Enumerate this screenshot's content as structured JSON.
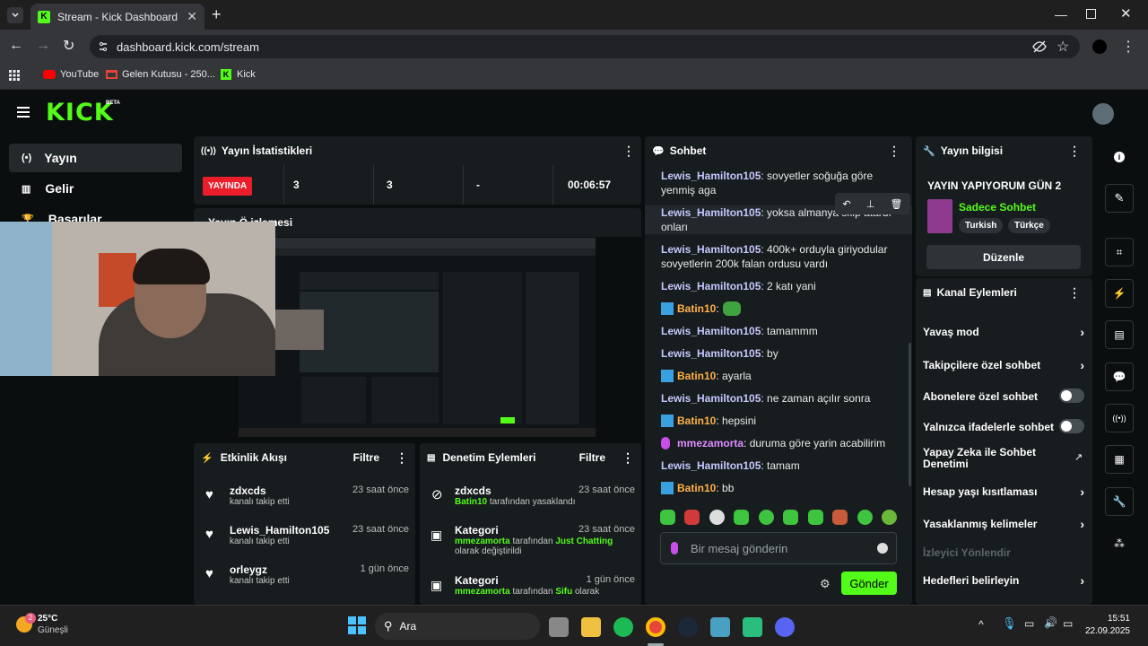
{
  "browser": {
    "tab_title": "Stream - Kick Dashboard",
    "url": "dashboard.kick.com/stream",
    "bookmarks": [
      "YouTube",
      "Gelen Kutusu - 250...",
      "Kick"
    ]
  },
  "brand": {
    "logo": "KICK",
    "beta": "BETA",
    "accent": "#53fc18"
  },
  "sidebar": {
    "items": [
      {
        "label": "Yayın"
      },
      {
        "label": "Gelir"
      },
      {
        "label": "Başarılar"
      }
    ]
  },
  "stats": {
    "title": "Yayın İstatistikleri",
    "live_badge": "YAYINDA",
    "values": [
      "3",
      "3",
      "-",
      "00:06:57"
    ]
  },
  "preview": {
    "title": "Yayın Önizlemesi",
    "title_visible": "Yayın Ö  izlemesi"
  },
  "activity": {
    "title": "Etkinlik Akışı",
    "filter": "Filtre",
    "items": [
      {
        "name": "zdxcds",
        "action": "kanalı takip etti",
        "time": "23 saat önce"
      },
      {
        "name": "Lewis_Hamilton105",
        "action": "kanalı takip etti",
        "time": "23 saat önce"
      },
      {
        "name": "orleygz",
        "action": "kanalı takip etti",
        "time": "1 gün önce"
      }
    ]
  },
  "moderation": {
    "title": "Denetim Eylemleri",
    "filter": "Filtre",
    "items": [
      {
        "name": "zdxcds",
        "actor": "Batin10",
        "text": "tarafından yasaklandı",
        "time": "23 saat önce"
      },
      {
        "name": "Kategori",
        "actor": "mmezamorta",
        "text": "tarafından",
        "target": "Just Chatting",
        "tail": "olarak değiştirildi",
        "time": "23 saat önce"
      },
      {
        "name": "Kategori",
        "actor": "mmezamorta",
        "text": "tarafından",
        "target": "Sifu",
        "tail": "olarak",
        "time": "1 gün önce"
      }
    ]
  },
  "chat": {
    "title": "Sohbet",
    "messages": [
      {
        "user": "Lewis_Hamilton105",
        "text": ": sovyetler soğuğa göre yenmiş aga"
      },
      {
        "user": "Lewis_Hamilton105",
        "text": ": yoksa almanya skip atardı onları"
      },
      {
        "user": "Lewis_Hamilton105",
        "text": ": 400k+ orduyla giriyodular sovyetlerin 200k falan ordusu vardı"
      },
      {
        "user": "Lewis_Hamilton105",
        "text": ": 2 katı yani"
      },
      {
        "user": "Batin10",
        "text": ":"
      },
      {
        "user": "Lewis_Hamilton105",
        "text": ": tamammm"
      },
      {
        "user": "Lewis_Hamilton105",
        "text": ": by"
      },
      {
        "user": "Batin10",
        "text": ": ayarla"
      },
      {
        "user": "Lewis_Hamilton105",
        "text": ": ne zaman açılır sonra"
      },
      {
        "user": "Batin10",
        "text": ": hepsini"
      },
      {
        "user": "mmezamorta",
        "text": ": duruma göre yarin acabilirim"
      },
      {
        "user": "Lewis_Hamilton105",
        "text": ": tamam"
      },
      {
        "user": "Batin10",
        "text": ": bb"
      }
    ],
    "input_placeholder": "Bir mesaj gönderin",
    "send_label": "Gönder"
  },
  "stream_info": {
    "title": "Yayın bilgisi",
    "stream_title": "YAYIN YAPIYORUM GÜN 2",
    "category": "Sadece Sohbet",
    "tags": [
      "Turkish",
      "Türkçe"
    ],
    "edit_label": "Düzenle"
  },
  "channel_actions": {
    "title": "Kanal Eylemleri",
    "options": [
      {
        "label": "Yavaş mod",
        "control": "chevron"
      },
      {
        "label": "Takipçilere özel sohbet",
        "control": "chevron"
      },
      {
        "label": "Abonelere özel sohbet",
        "control": "toggle"
      },
      {
        "label": "Yalnızca ifadelerle sohbet",
        "control": "toggle"
      },
      {
        "label": "Yapay Zeka ile Sohbet Denetimi",
        "control": "external"
      },
      {
        "label": "Hesap yaşı kısıtlaması",
        "control": "chevron"
      },
      {
        "label": "Yasaklanmış kelimeler",
        "control": "chevron"
      },
      {
        "label": "İzleyici Yönlendir",
        "control": "none"
      },
      {
        "label": "Hedefleri belirleyin",
        "control": "chevron"
      }
    ]
  },
  "taskbar": {
    "temp": "25°C",
    "weather": "Güneşli",
    "badge": "2",
    "search": "Ara",
    "time": "15:51",
    "date": "22.09.2025"
  }
}
